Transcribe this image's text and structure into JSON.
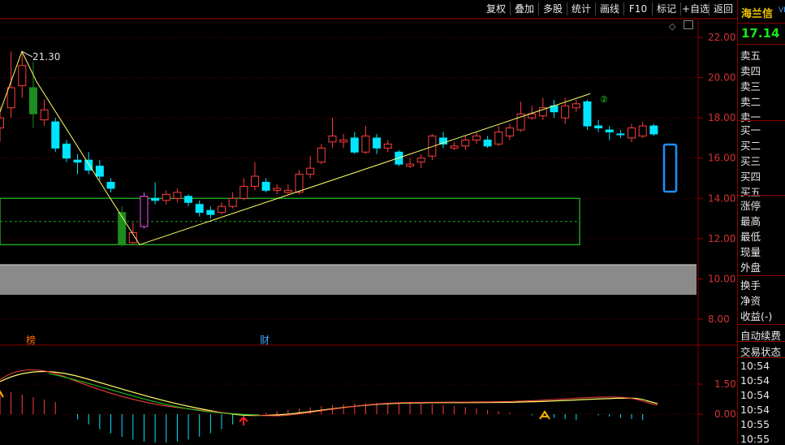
{
  "toolbar": {
    "buttons": [
      "复权",
      "叠加",
      "多股",
      "统计",
      "画线",
      "F10",
      "标记",
      "+自选",
      "返回"
    ]
  },
  "quote": {
    "name": "海兰信",
    "code_tag": "VD",
    "price": "17.14",
    "book_labels": [
      "卖五",
      "卖四",
      "卖三",
      "卖二",
      "卖一",
      "买一",
      "买二",
      "买三",
      "买四",
      "买五"
    ],
    "stat_labels": [
      "涨停",
      "最高",
      "最低",
      "现量",
      "外盘"
    ],
    "extra_labels": [
      "换手",
      "净资",
      "收益(-)"
    ],
    "auto_fee": "自动续费",
    "trade_status": "交易状态",
    "times": [
      "10:54",
      "10:54",
      "10:54",
      "10:54",
      "10:55",
      "10:55"
    ]
  },
  "main_axis": {
    "ticks": [
      "22.00",
      "20.00",
      "18.00",
      "16.00",
      "14.00",
      "12.00",
      "10.00",
      "8.00"
    ]
  },
  "sub_axis": {
    "ticks": [
      "1.50",
      "0.00"
    ]
  },
  "annotations": {
    "peak_label": "21.30",
    "circle_label": "②",
    "event_rank": "榜",
    "event_finance": "财"
  },
  "chart_data": {
    "type": "candlestick",
    "ylim": [
      7.0,
      23.0
    ],
    "candles": [
      {
        "o": 17.5,
        "c": 18.0,
        "h": 18.6,
        "l": 16.8,
        "up": true
      },
      {
        "o": 18.5,
        "c": 19.5,
        "h": 21.3,
        "l": 18.0,
        "up": true
      },
      {
        "o": 19.6,
        "c": 20.6,
        "h": 21.3,
        "l": 19.0,
        "up": true
      },
      {
        "o": 19.5,
        "c": 18.2,
        "h": 20.8,
        "l": 17.5,
        "up": false,
        "green": true
      },
      {
        "o": 17.9,
        "c": 18.4,
        "h": 18.9,
        "l": 17.6,
        "up": true
      },
      {
        "o": 17.8,
        "c": 16.5,
        "h": 18.0,
        "l": 16.3,
        "up": false
      },
      {
        "o": 16.7,
        "c": 16.0,
        "h": 16.9,
        "l": 15.8,
        "up": false
      },
      {
        "o": 15.9,
        "c": 15.8,
        "h": 16.2,
        "l": 15.2,
        "up": false
      },
      {
        "o": 15.9,
        "c": 15.4,
        "h": 16.3,
        "l": 15.2,
        "up": false
      },
      {
        "o": 15.6,
        "c": 15.1,
        "h": 15.9,
        "l": 14.9,
        "up": false
      },
      {
        "o": 14.8,
        "c": 14.5,
        "h": 15.0,
        "l": 14.3,
        "up": false
      },
      {
        "o": 13.3,
        "c": 11.7,
        "h": 13.6,
        "l": 11.6,
        "up": false,
        "green": true
      },
      {
        "o": 11.8,
        "c": 12.3,
        "h": 12.8,
        "l": 11.7,
        "up": true
      },
      {
        "o": 12.6,
        "c": 14.1,
        "h": 14.3,
        "l": 12.5,
        "up": true,
        "magenta": true
      },
      {
        "o": 14.0,
        "c": 13.9,
        "h": 14.8,
        "l": 13.7,
        "up": false
      },
      {
        "o": 13.9,
        "c": 14.2,
        "h": 14.4,
        "l": 13.7,
        "up": true
      },
      {
        "o": 14.3,
        "c": 14.0,
        "h": 14.5,
        "l": 13.8,
        "up": true
      },
      {
        "o": 14.1,
        "c": 13.8,
        "h": 14.2,
        "l": 13.6,
        "up": false
      },
      {
        "o": 13.7,
        "c": 13.3,
        "h": 13.9,
        "l": 13.1,
        "up": false
      },
      {
        "o": 13.4,
        "c": 13.2,
        "h": 13.6,
        "l": 13.0,
        "up": false
      },
      {
        "o": 13.3,
        "c": 13.6,
        "h": 13.8,
        "l": 13.2,
        "up": true
      },
      {
        "o": 13.6,
        "c": 14.0,
        "h": 14.3,
        "l": 13.5,
        "up": true
      },
      {
        "o": 14.0,
        "c": 14.6,
        "h": 15.0,
        "l": 13.9,
        "up": true
      },
      {
        "o": 14.6,
        "c": 15.1,
        "h": 15.8,
        "l": 14.4,
        "up": true
      },
      {
        "o": 14.8,
        "c": 14.4,
        "h": 15.0,
        "l": 14.3,
        "up": false
      },
      {
        "o": 14.4,
        "c": 14.5,
        "h": 14.7,
        "l": 14.2,
        "up": true
      },
      {
        "o": 14.3,
        "c": 14.4,
        "h": 14.7,
        "l": 14.2,
        "up": true
      },
      {
        "o": 14.3,
        "c": 15.2,
        "h": 15.4,
        "l": 14.2,
        "up": true
      },
      {
        "o": 15.2,
        "c": 15.5,
        "h": 16.1,
        "l": 15.0,
        "up": true
      },
      {
        "o": 15.8,
        "c": 16.5,
        "h": 16.7,
        "l": 15.7,
        "up": true
      },
      {
        "o": 16.8,
        "c": 17.1,
        "h": 18.0,
        "l": 16.5,
        "up": true
      },
      {
        "o": 16.9,
        "c": 16.8,
        "h": 17.2,
        "l": 16.5,
        "up": true
      },
      {
        "o": 17.0,
        "c": 16.3,
        "h": 17.3,
        "l": 16.2,
        "up": false
      },
      {
        "o": 16.3,
        "c": 17.1,
        "h": 17.6,
        "l": 16.2,
        "up": true
      },
      {
        "o": 17.0,
        "c": 16.5,
        "h": 17.2,
        "l": 16.2,
        "up": false
      },
      {
        "o": 16.5,
        "c": 16.7,
        "h": 16.9,
        "l": 16.3,
        "up": true
      },
      {
        "o": 16.3,
        "c": 15.7,
        "h": 16.4,
        "l": 15.6,
        "up": false
      },
      {
        "o": 15.7,
        "c": 15.6,
        "h": 16.0,
        "l": 15.5,
        "up": true
      },
      {
        "o": 15.8,
        "c": 16.0,
        "h": 16.2,
        "l": 15.5,
        "up": true
      },
      {
        "o": 16.1,
        "c": 17.1,
        "h": 17.2,
        "l": 15.9,
        "up": true
      },
      {
        "o": 17.0,
        "c": 16.7,
        "h": 17.3,
        "l": 16.5,
        "up": false
      },
      {
        "o": 16.5,
        "c": 16.6,
        "h": 16.8,
        "l": 16.4,
        "up": true
      },
      {
        "o": 16.6,
        "c": 16.9,
        "h": 17.1,
        "l": 16.4,
        "up": true
      },
      {
        "o": 16.9,
        "c": 17.1,
        "h": 17.3,
        "l": 16.7,
        "up": true
      },
      {
        "o": 16.9,
        "c": 16.6,
        "h": 17.1,
        "l": 16.5,
        "up": false
      },
      {
        "o": 16.7,
        "c": 17.3,
        "h": 17.6,
        "l": 16.6,
        "up": true
      },
      {
        "o": 17.1,
        "c": 17.5,
        "h": 17.7,
        "l": 16.9,
        "up": true
      },
      {
        "o": 17.4,
        "c": 18.2,
        "h": 18.8,
        "l": 17.3,
        "up": true
      },
      {
        "o": 18.0,
        "c": 18.2,
        "h": 18.6,
        "l": 17.9,
        "up": true
      },
      {
        "o": 18.1,
        "c": 18.5,
        "h": 19.0,
        "l": 17.9,
        "up": true
      },
      {
        "o": 18.6,
        "c": 18.3,
        "h": 18.9,
        "l": 18.0,
        "up": false
      },
      {
        "o": 18.0,
        "c": 18.6,
        "h": 19.0,
        "l": 17.7,
        "up": true
      },
      {
        "o": 18.5,
        "c": 18.7,
        "h": 18.9,
        "l": 18.3,
        "up": true
      },
      {
        "o": 18.8,
        "c": 17.6,
        "h": 18.9,
        "l": 17.4,
        "up": false
      },
      {
        "o": 17.6,
        "c": 17.5,
        "h": 17.9,
        "l": 17.3,
        "up": false
      },
      {
        "o": 17.4,
        "c": 17.3,
        "h": 17.6,
        "l": 16.9,
        "up": false
      },
      {
        "o": 17.2,
        "c": 17.2,
        "h": 17.4,
        "l": 17.0,
        "up": false
      },
      {
        "o": 17.0,
        "c": 17.5,
        "h": 17.7,
        "l": 16.8,
        "up": true
      },
      {
        "o": 17.1,
        "c": 17.6,
        "h": 17.8,
        "l": 17.0,
        "up": true
      },
      {
        "o": 17.6,
        "c": 17.2,
        "h": 17.7,
        "l": 17.1,
        "up": false
      }
    ]
  }
}
